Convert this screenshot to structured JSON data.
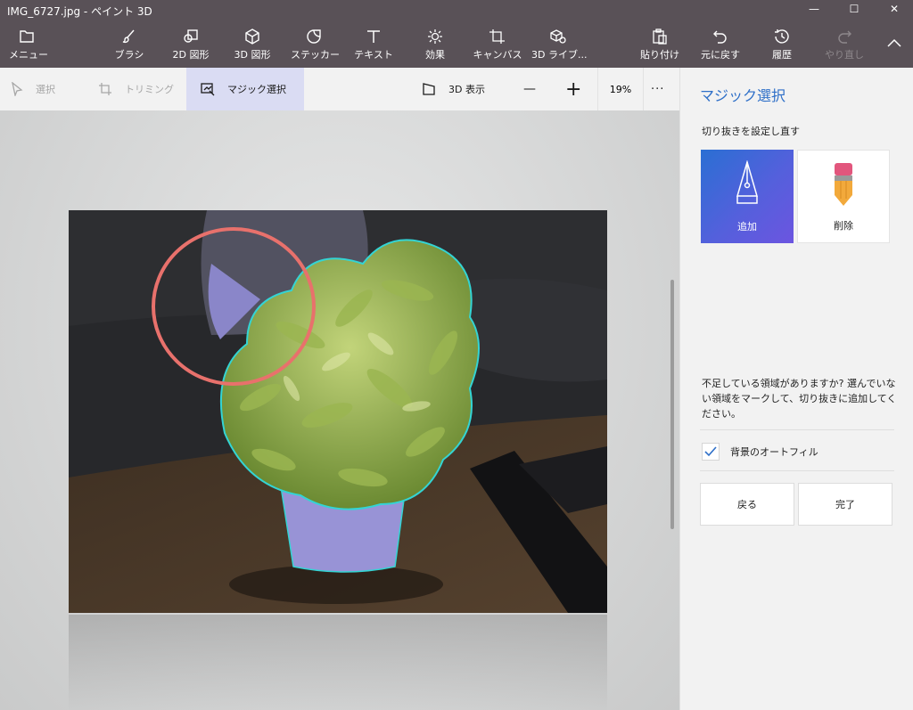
{
  "window": {
    "title": "IMG_6727.jpg - ペイント 3D",
    "minimize": "—",
    "maximize": "☐",
    "close": "✕"
  },
  "toolbar": {
    "menu": "メニュー",
    "brush": "ブラシ",
    "shapes_2d": "2D 図形",
    "shapes_3d": "3D 図形",
    "stickers": "ステッカー",
    "text": "テキスト",
    "effects": "効果",
    "canvas": "キャンバス",
    "library_3d": "3D ライブ...",
    "paste": "貼り付け",
    "undo": "元に戻す",
    "history": "履歴",
    "redo": "やり直し"
  },
  "subtoolbar": {
    "select": "選択",
    "crop": "トリミング",
    "magic_select": "マジック選択",
    "view_3d": "3D 表示",
    "zoom_out": "—",
    "zoom_in": "+",
    "zoom": "19%",
    "more": "···"
  },
  "panel": {
    "title": "マジック選択",
    "subtitle": "切り抜きを設定し直す",
    "add": "追加",
    "remove": "削除",
    "message": "不足している領域がありますか? 選んでいない領域をマークして、切り抜きに追加してください。",
    "autofill": "背景のオートフィル",
    "autofill_checked": true,
    "back": "戻る",
    "done": "完了"
  },
  "colors": {
    "accent": "#2e6fc8",
    "toolbar_bg": "#595157",
    "selection_outline": "#33d4d4",
    "highlight_circle": "#e8716c"
  }
}
